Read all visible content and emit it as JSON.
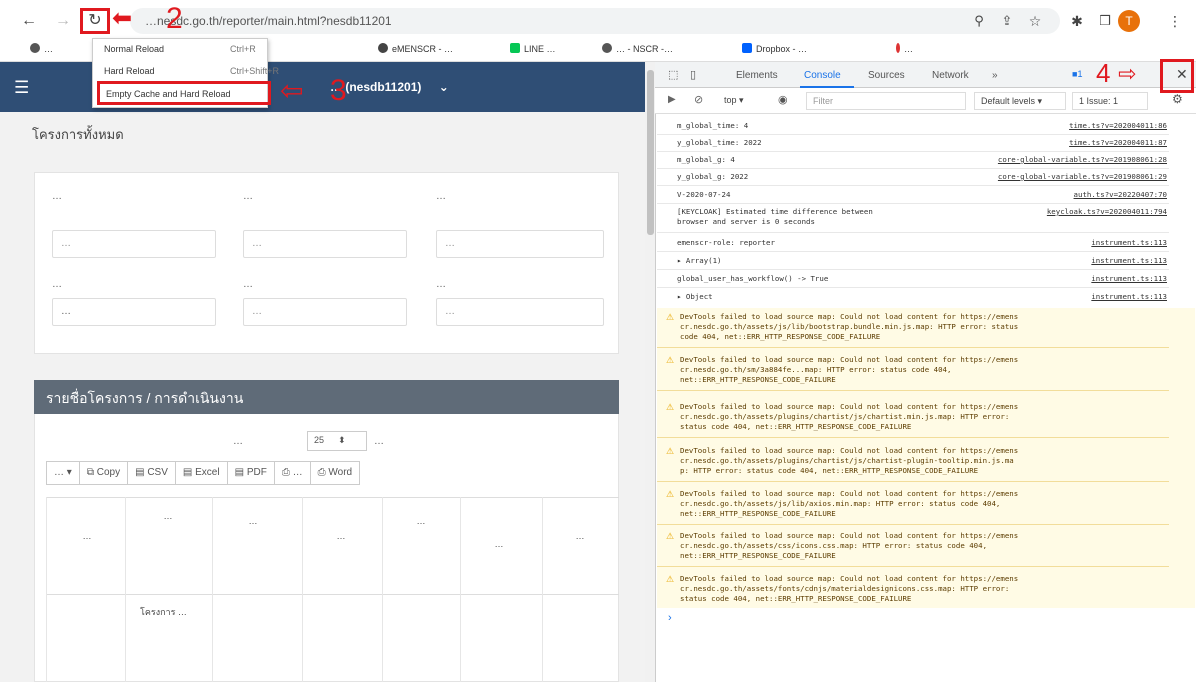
{
  "browser": {
    "url": "…nesdc.go.th/reporter/main.html?nesdb11201",
    "bookmarks": [
      {
        "label": "…"
      },
      {
        "label": "eMENSCR - …"
      },
      {
        "label": "LINE …"
      },
      {
        "label": "… - NSCR -…"
      },
      {
        "label": "Dropbox - …"
      },
      {
        "label": "…"
      }
    ],
    "avatar_letter": "T"
  },
  "context_menu": {
    "items": [
      {
        "label": "Normal Reload",
        "shortcut": "Ctrl+R"
      },
      {
        "label": "Hard Reload",
        "shortcut": "Ctrl+Shift+R"
      },
      {
        "label": "Empty Cache and Hard Reload",
        "shortcut": ""
      }
    ]
  },
  "annotations": {
    "n2": "2",
    "n3": "3",
    "n4": "4"
  },
  "page": {
    "nav_title": "… (nesdb11201)",
    "title": "โครงการทั้งหมด",
    "filters": [
      {
        "label": "…",
        "value": "…"
      },
      {
        "label": "…",
        "value": "…"
      },
      {
        "label": "…",
        "value": "…"
      },
      {
        "label": "…",
        "value": "…"
      },
      {
        "label": "…",
        "value": "…"
      },
      {
        "label": "…",
        "value": "…"
      }
    ],
    "list_title": "รายชื่อโครงการ / การดำเนินงาน",
    "length_label": "…",
    "length_value": "25",
    "length_suffix": "…",
    "buttons": [
      "… ▾",
      "Copy",
      "CSV",
      "Excel",
      "PDF",
      "…",
      "Word"
    ],
    "columns": [
      "…",
      "…",
      "…",
      "…",
      "…",
      "…",
      "…"
    ],
    "first_cell": "โครงการ …"
  },
  "devtools": {
    "tabs": [
      "Elements",
      "Console",
      "Sources",
      "Network",
      "»"
    ],
    "issues_badge": "1",
    "toolbar": {
      "context": "top ▾",
      "filter_placeholder": "Filter",
      "levels": "Default levels ▾",
      "issues": "1 Issue: 1"
    },
    "logs": [
      {
        "text": "m_global_time:  4",
        "src": "time.ts?v=202004011:86"
      },
      {
        "text": "y_global_time:  2022",
        "src": "time.ts?v=202004011:87"
      },
      {
        "text": "m_global_g:  4",
        "src": "core-global-variable.ts?v=201908061:28"
      },
      {
        "text": "y_global_g:  2022",
        "src": "core-global-variable.ts?v=201908061:29"
      },
      {
        "text": "V-2020-07-24",
        "src": "auth.ts?v=20220407:70"
      },
      {
        "text": "[KEYCLOAK] Estimated time difference between",
        "text2": "browser and server is 0 seconds",
        "src": "keycloak.ts?v=202004011:794"
      },
      {
        "text": "emenscr-role:  reporter",
        "src": "instrument.ts:113"
      },
      {
        "text": "▸ Array(1)",
        "src": "instrument.ts:113"
      },
      {
        "text": "global_user_has_workflow() -> True",
        "src": "instrument.ts:113"
      },
      {
        "text": "▸ Object",
        "src": "instrument.ts:113"
      }
    ],
    "warnings": [
      {
        "l1": "DevTools failed to load source map: Could not load content for https://emens",
        "l2": "cr.nesdc.go.th/assets/js/lib/bootstrap.bundle.min.js.map: HTTP error: status",
        "l3": "code 404, net::ERR_HTTP_RESPONSE_CODE_FAILURE"
      },
      {
        "l1": "DevTools failed to load source map: Could not load content for https://emens",
        "l2": "cr.nesdc.go.th/sm/3a884fe...map: HTTP error: status code 404,",
        "l3": "net::ERR_HTTP_RESPONSE_CODE_FAILURE"
      },
      {
        "l1": "DevTools failed to load source map: Could not load content for https://emens",
        "l2": "cr.nesdc.go.th/assets/plugins/chartist/js/chartist.min.js.map: HTTP error:",
        "l3": "status code 404, net::ERR_HTTP_RESPONSE_CODE_FAILURE"
      },
      {
        "l1": "DevTools failed to load source map: Could not load content for https://emens",
        "l2": "cr.nesdc.go.th/assets/plugins/chartist/js/chartist-plugin-tooltip.min.js.ma",
        "l3": "p: HTTP error: status code 404, net::ERR_HTTP_RESPONSE_CODE_FAILURE"
      },
      {
        "l1": "DevTools failed to load source map: Could not load content for https://emens",
        "l2": "cr.nesdc.go.th/assets/js/lib/axios.min.map: HTTP error: status code 404,",
        "l3": "net::ERR_HTTP_RESPONSE_CODE_FAILURE"
      },
      {
        "l1": "DevTools failed to load source map: Could not load content for https://emens",
        "l2": "cr.nesdc.go.th/assets/css/icons.css.map: HTTP error: status code 404,",
        "l3": "net::ERR_HTTP_RESPONSE_CODE_FAILURE"
      },
      {
        "l1": "DevTools failed to load source map: Could not load content for https://emens",
        "l2": "cr.nesdc.go.th/assets/fonts/cdnjs/materialdesignicons.css.map: HTTP error:",
        "l3": "status code 404, net::ERR_HTTP_RESPONSE_CODE_FAILURE"
      }
    ],
    "prompt": "›"
  }
}
